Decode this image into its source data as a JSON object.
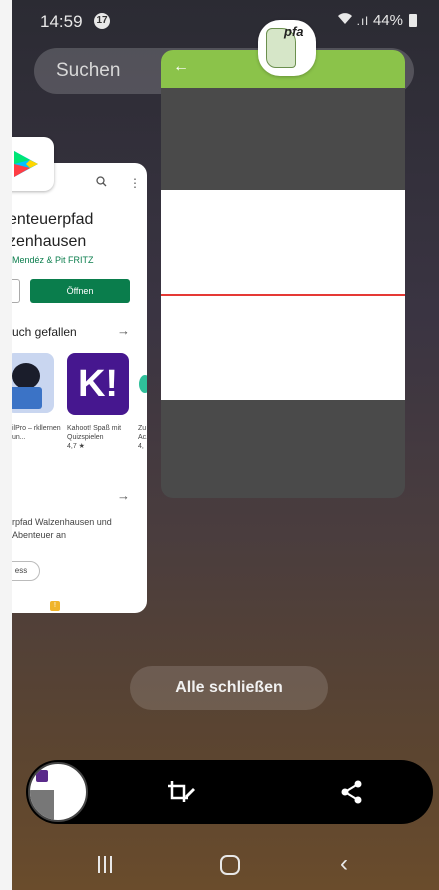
{
  "status_bar": {
    "time": "14:59",
    "notification_count": "17",
    "battery": "44%"
  },
  "search": {
    "placeholder": "Suchen"
  },
  "play_store_card": {
    "title_line1": "enteuerpfad",
    "title_line2": "zenhausen",
    "developer": "Mendéz & Pit FRITZ",
    "open_button": "Öffnen",
    "section_title": "uch gefallen",
    "apps": [
      {
        "label": "ilPro – rkllernen un..."
      },
      {
        "label": "Kahoot! Spaß mit Quizspielen",
        "rating": "4,7 ★"
      },
      {
        "label": "Zu Ac...",
        "rating": "4,"
      }
    ],
    "kahoot_letter": "K!",
    "description": "rpfad Walzenhausen und Abenteuer an",
    "chip": "ess",
    "colors": {
      "primary_green": "#0a7d4c",
      "kahoot_purple": "#46178f"
    }
  },
  "center_card": {
    "app_icon_text": "pfa",
    "toolbar_color": "#8bc34a",
    "line_color": "#e53935"
  },
  "close_all": {
    "label": "Alle schließen"
  },
  "action_bar": {
    "icons": [
      "screenshot-thumbnail",
      "crop-edit-icon",
      "share-icon"
    ]
  },
  "nav_bar": {
    "icons": [
      "recents-icon",
      "home-icon",
      "back-icon"
    ]
  }
}
